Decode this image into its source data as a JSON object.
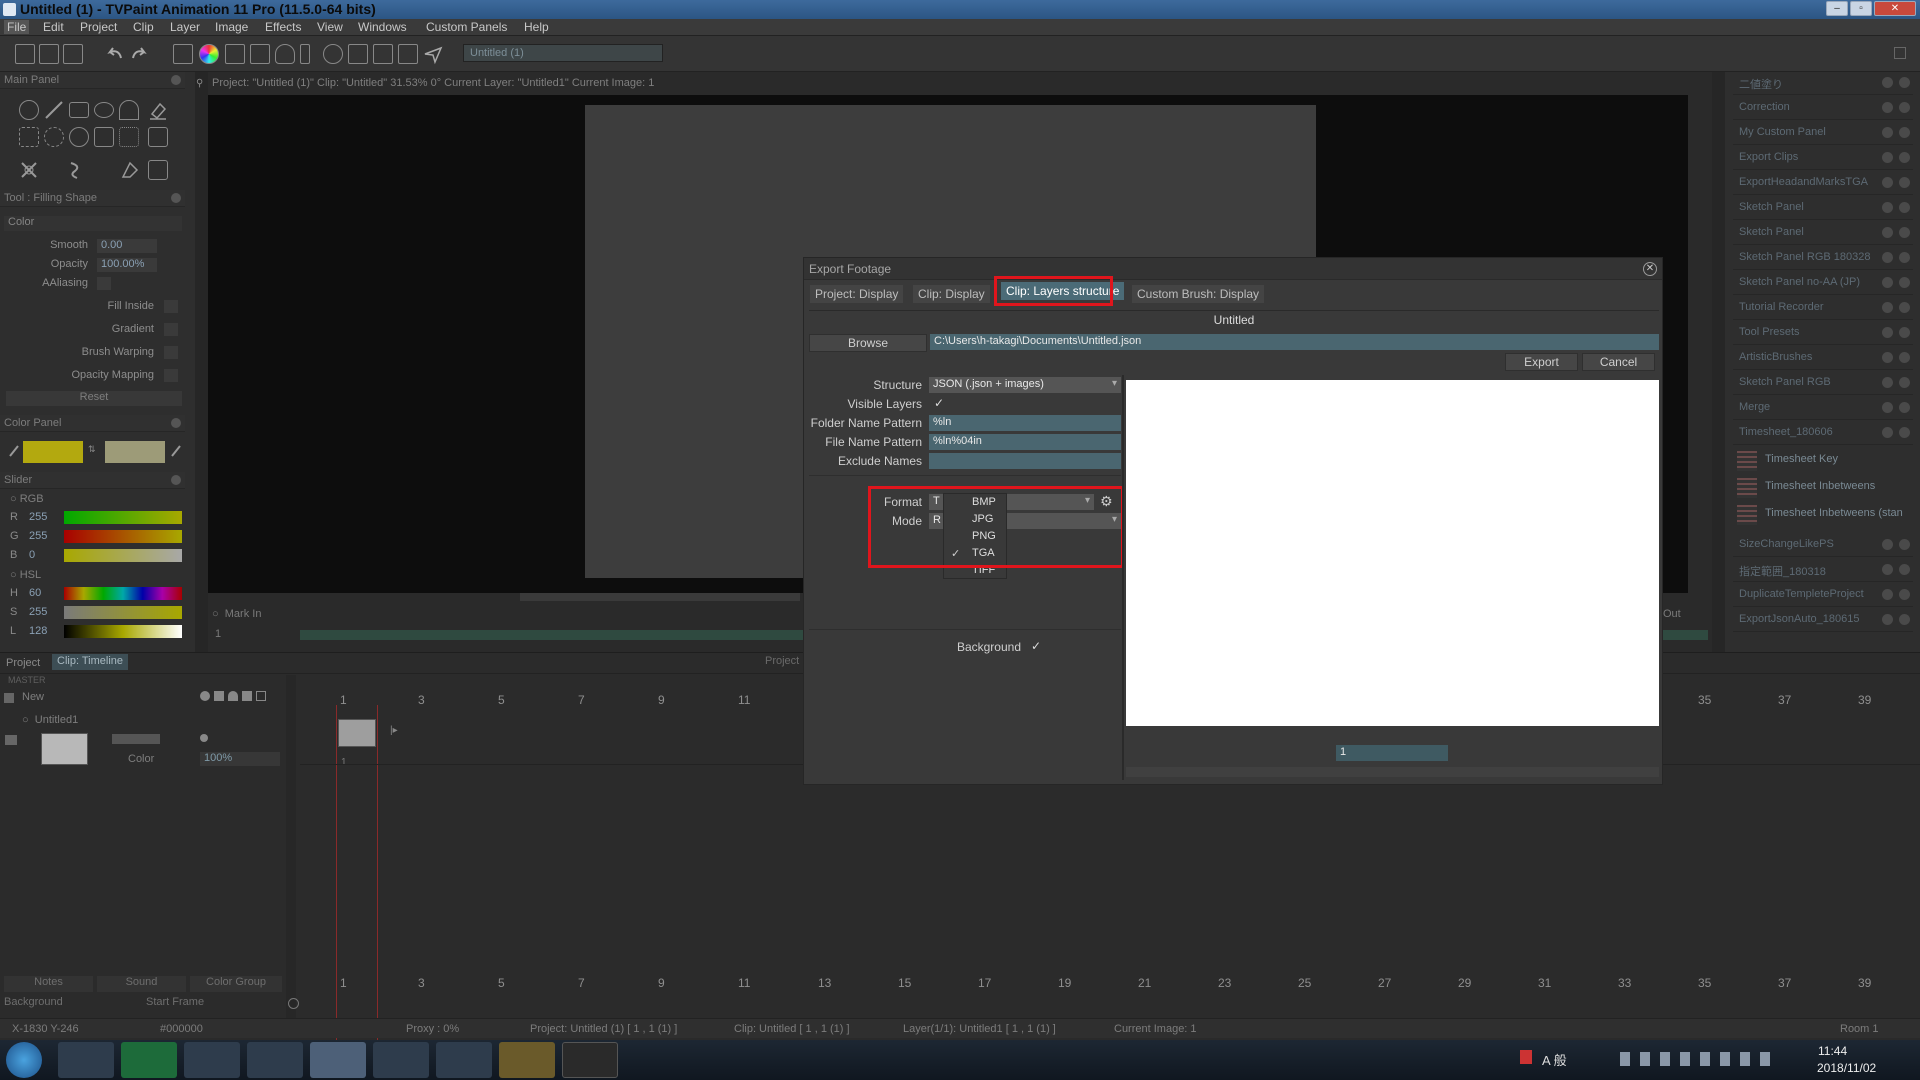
{
  "window": {
    "title": "Untitled (1) - TVPaint Animation 11 Pro (11.5.0-64 bits)"
  },
  "menu": [
    "File",
    "Edit",
    "Project",
    "Clip",
    "Layer",
    "Image",
    "Effects",
    "View",
    "Windows",
    "Custom Panels",
    "Help"
  ],
  "toolbar": {
    "project_field": "Untitled (1)"
  },
  "main_panel": {
    "title": "Main Panel"
  },
  "tool_panel": {
    "title": "Tool : Filling Shape",
    "color_label": "Color",
    "smooth_label": "Smooth",
    "smooth_value": "0.00",
    "opacity_label": "Opacity",
    "opacity_value": "100.00%",
    "aaliasing_label": "AAliasing",
    "fill_inside": "Fill Inside",
    "gradient": "Gradient",
    "brush_warping": "Brush Warping",
    "opacity_mapping": "Opacity Mapping",
    "reset": "Reset"
  },
  "color_panel": {
    "title": "Color Panel",
    "fg": "#b3a90f",
    "bg": "#9d9b78"
  },
  "slider_panel": {
    "title": "Slider",
    "rgb_label": "RGB",
    "hsl_label": "HSL",
    "r_label": "R",
    "r_value": "255",
    "g_label": "G",
    "g_value": "255",
    "b_label": "B",
    "b_value": "0",
    "h_label": "H",
    "h_value": "60",
    "s_label": "S",
    "s_value": "255",
    "l_label": "L",
    "l_value": "128"
  },
  "stage": {
    "info": "Project: \"Untitled (1)\"  Clip: \"Untitled\"   31.53%   0°  Current Layer: \"Untitled1\"  Current Image: 1",
    "mark_in": "Mark In",
    "frame": "1",
    "out_label": "Out"
  },
  "right_panels": {
    "items": [
      "二値塗り",
      "Correction",
      "My Custom Panel",
      "Export Clips",
      "ExportHeadandMarksTGA",
      "Sketch Panel",
      "Sketch Panel",
      "Sketch Panel RGB 180328",
      "Sketch Panel no-AA (JP)",
      "Tutorial Recorder",
      "Tool Presets",
      "ArtisticBrushes",
      "Sketch Panel RGB",
      "Merge",
      "Timesheet_180606"
    ],
    "timesheet": [
      "Timesheet Key",
      "Timesheet Inbetweens",
      "Timesheet Inbetweens (stan"
    ],
    "lower": [
      "SizeChangeLikePS",
      "指定範囲_180318",
      "DuplicateTempleteProject",
      "ExportJsonAuto_180615"
    ]
  },
  "dialog": {
    "title": "Export Footage",
    "tabs": [
      "Project: Display",
      "Clip: Display",
      "Clip: Layers structure",
      "Custom Brush: Display"
    ],
    "name": "Untitled",
    "browse": "Browse",
    "path": "C:\\Users\\h-takagi\\Documents\\Untitled.json",
    "export": "Export",
    "cancel": "Cancel",
    "structure_label": "Structure",
    "structure_value": "JSON (.json + images)",
    "visible_layers_label": "Visible Layers",
    "folder_label": "Folder Name Pattern",
    "folder_value": "%ln",
    "file_label": "File Name Pattern",
    "file_value": "%ln%04in",
    "exclude_label": "Exclude Names",
    "exclude_value": "",
    "format_label": "Format",
    "format_value": "T",
    "mode_label": "Mode",
    "mode_value": "R",
    "format_options": [
      "BMP",
      "JPG",
      "PNG",
      "TGA",
      "TIFF"
    ],
    "format_selected": "TGA",
    "background_label": "Background",
    "frame_value": "1"
  },
  "timeline": {
    "project_tab": "Project",
    "clip_tab": "Clip: Timeline",
    "project_hdr": "Project",
    "master": "MASTER",
    "new": "New",
    "layer_name": "Untitled1",
    "color_label": "Color",
    "opacity_value": "100%",
    "ticks_top": [
      "1",
      "3",
      "5",
      "7",
      "9",
      "11",
      "35",
      "37",
      "39"
    ],
    "ticks_bottom": [
      "1",
      "3",
      "5",
      "7",
      "9",
      "11",
      "13",
      "15",
      "17",
      "19",
      "21",
      "23",
      "25",
      "27",
      "29",
      "31",
      "33",
      "35",
      "37",
      "39"
    ],
    "frame_num": "1",
    "notes": "Notes",
    "sound": "Sound",
    "color_group": "Color Group",
    "background": "Background",
    "start_frame": "Start Frame"
  },
  "status": {
    "coords": "X-1830  Y-246",
    "color": "#000000",
    "proxy": "Proxy : 0%",
    "project": "Project: Untitled (1) [ 1 , 1  (1) ]",
    "clip": "Clip: Untitled [ 1 , 1  (1) ]",
    "layer": "Layer(1/1): Untitled1 [ 1 , 1  (1) ]",
    "image": "Current Image: 1",
    "room": "Room 1"
  },
  "taskbar": {
    "time": "11:44",
    "date": "2018/11/02",
    "ime": "A 般"
  }
}
